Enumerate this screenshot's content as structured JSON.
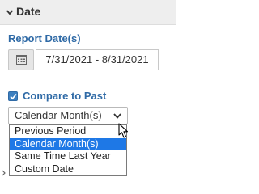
{
  "section": {
    "title": "Date"
  },
  "report_dates": {
    "label": "Report Date(s)",
    "value": "7/31/2021 - 8/31/2021"
  },
  "compare": {
    "label": "Compare to Past",
    "checked": true,
    "selected": "Calendar Month(s)",
    "options": [
      "Previous Period",
      "Calendar Month(s)",
      "Same Time Last Year",
      "Custom Date"
    ]
  },
  "colors": {
    "accent": "#2f6aa6",
    "selected_option_bg": "#1e78e6"
  },
  "icons": {
    "collapse": "chevron-down-icon",
    "calendar": "calendar-icon",
    "checkbox": "checkmark-icon",
    "select_arrow": "chevron-down-icon",
    "pointer": "mouse-cursor-icon"
  }
}
